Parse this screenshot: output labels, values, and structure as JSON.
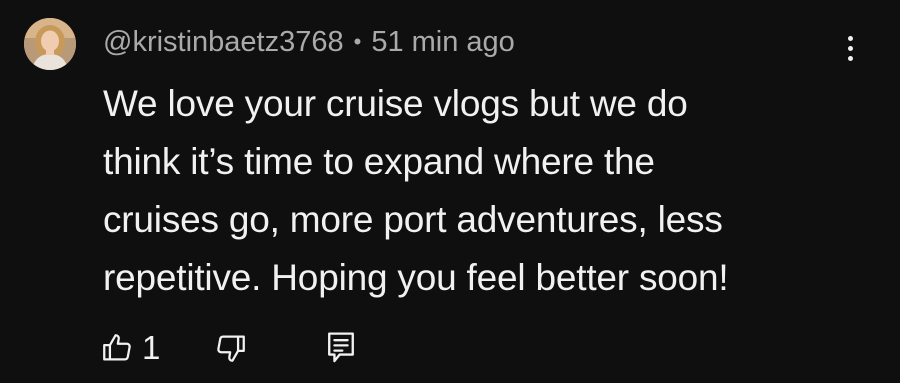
{
  "comment": {
    "author": "@kristinbaetz3768",
    "separator": "•",
    "timestamp": "51 min ago",
    "text_lines": [
      "We love your cruise vlogs but we do",
      "think it’s time to expand where the",
      "cruises go, more port adventures, less",
      "repetitive. Hoping you feel better soon!"
    ],
    "like_count": "1",
    "icons": {
      "avatar": "avatar",
      "menu": "more-vert-icon",
      "like": "thumbs-up-icon",
      "dislike": "thumbs-down-icon",
      "reply": "reply-icon"
    },
    "colors": {
      "background": "#0f0f0f",
      "text": "#f1f1f1",
      "meta": "#aaaaaa"
    }
  }
}
